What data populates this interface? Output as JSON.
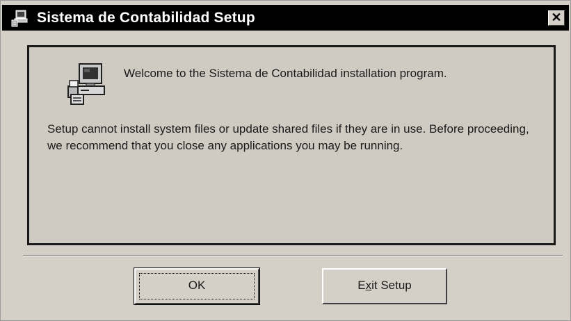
{
  "window": {
    "title": "Sistema de Contabilidad Setup",
    "close_label": "✕",
    "title_icon": "setup-computer-icon"
  },
  "content": {
    "icon": "computer-install-icon",
    "welcome": "Welcome to the Sistema de Contabilidad installation program.",
    "message": "Setup cannot install system files or update shared files if they are in use. Before proceeding, we recommend that you close any applications you may be running."
  },
  "buttons": {
    "ok_label": "OK",
    "exit_label": "Exit Setup",
    "exit_mnemonic": "x",
    "exit_prefix": "E",
    "exit_suffix": "it Setup"
  },
  "colors": {
    "title_bar": "#000000",
    "dialog_face": "#d4d0c8"
  }
}
